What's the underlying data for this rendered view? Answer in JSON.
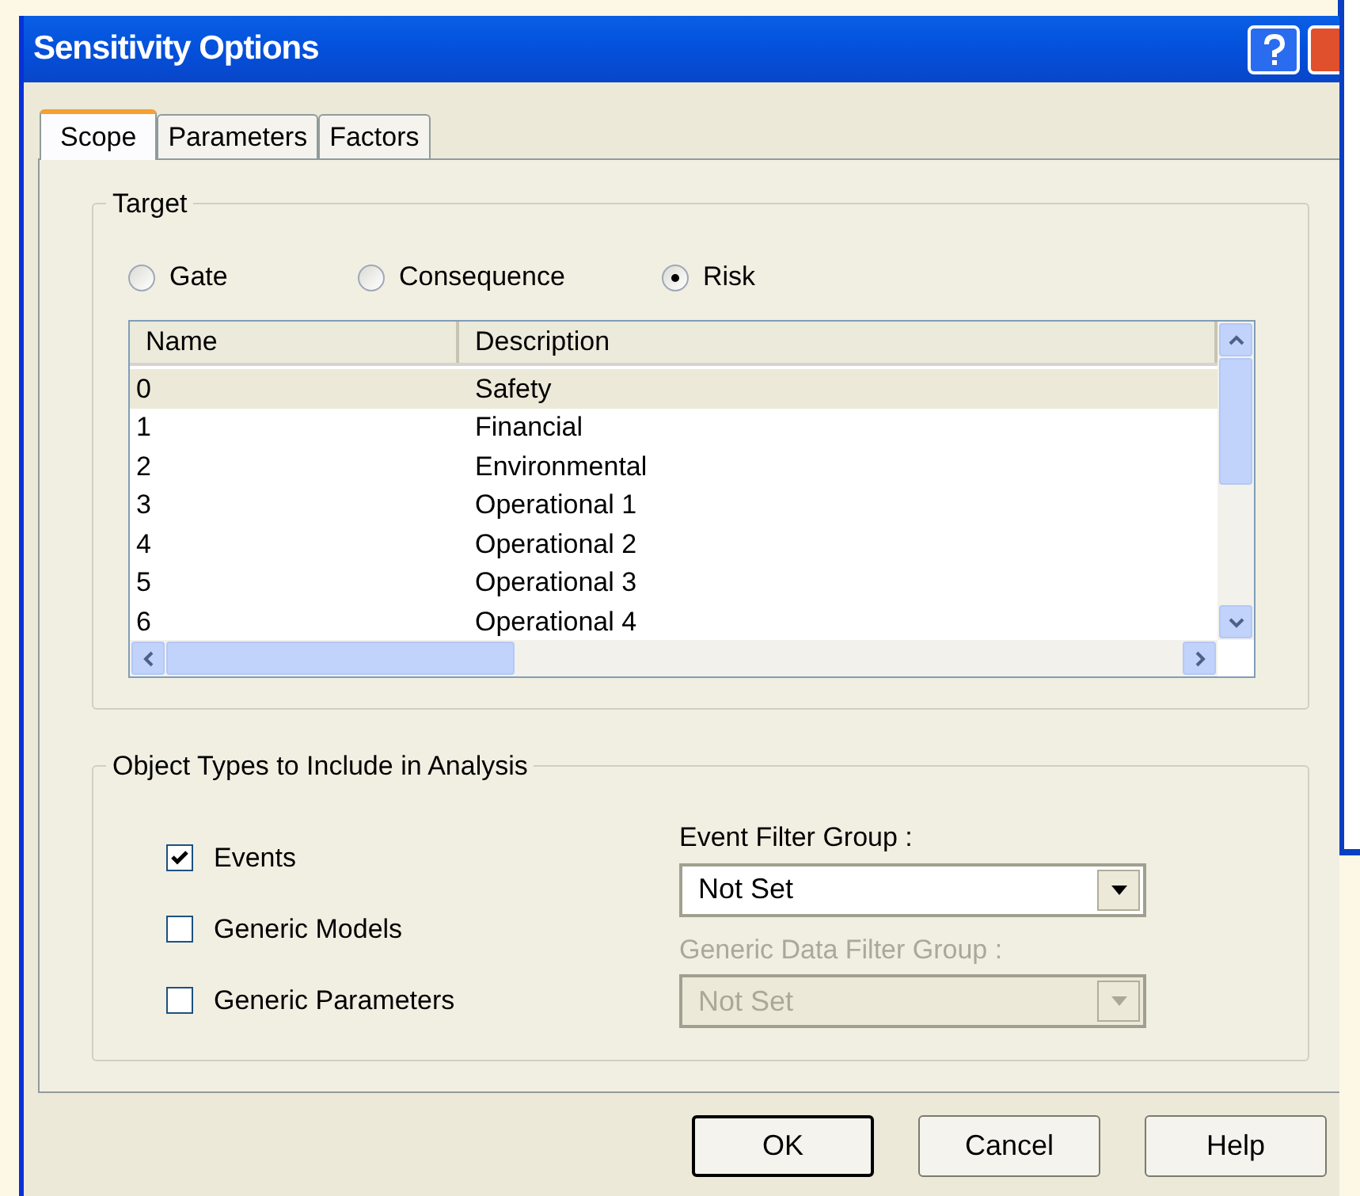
{
  "window": {
    "title": "Sensitivity Options"
  },
  "tabs": [
    {
      "label": "Scope",
      "selected": true
    },
    {
      "label": "Parameters",
      "selected": false
    },
    {
      "label": "Factors",
      "selected": false
    }
  ],
  "target": {
    "title": "Target",
    "options": [
      {
        "label": "Gate",
        "selected": false
      },
      {
        "label": "Consequence",
        "selected": false
      },
      {
        "label": "Risk",
        "selected": true
      }
    ],
    "table": {
      "columns": [
        "Name",
        "Description"
      ],
      "rows": [
        {
          "name": "0",
          "description": "Safety",
          "selected": true
        },
        {
          "name": "1",
          "description": "Financial",
          "selected": false
        },
        {
          "name": "2",
          "description": "Environmental",
          "selected": false
        },
        {
          "name": "3",
          "description": "Operational 1",
          "selected": false
        },
        {
          "name": "4",
          "description": "Operational 2",
          "selected": false
        },
        {
          "name": "5",
          "description": "Operational 3",
          "selected": false
        },
        {
          "name": "6",
          "description": "Operational 4",
          "selected": false
        }
      ]
    }
  },
  "object_types": {
    "title": "Object Types to Include in Analysis",
    "checkboxes": [
      {
        "label": "Events",
        "checked": true
      },
      {
        "label": "Generic Models",
        "checked": false
      },
      {
        "label": "Generic Parameters",
        "checked": false
      }
    ],
    "filters": [
      {
        "label": "Event Filter Group :",
        "value": "Not Set",
        "disabled": false
      },
      {
        "label": "Generic Data Filter Group :",
        "value": "Not Set",
        "disabled": true
      }
    ]
  },
  "buttons": [
    {
      "label": "OK",
      "default": true
    },
    {
      "label": "Cancel",
      "default": false
    },
    {
      "label": "Help",
      "default": false
    }
  ]
}
